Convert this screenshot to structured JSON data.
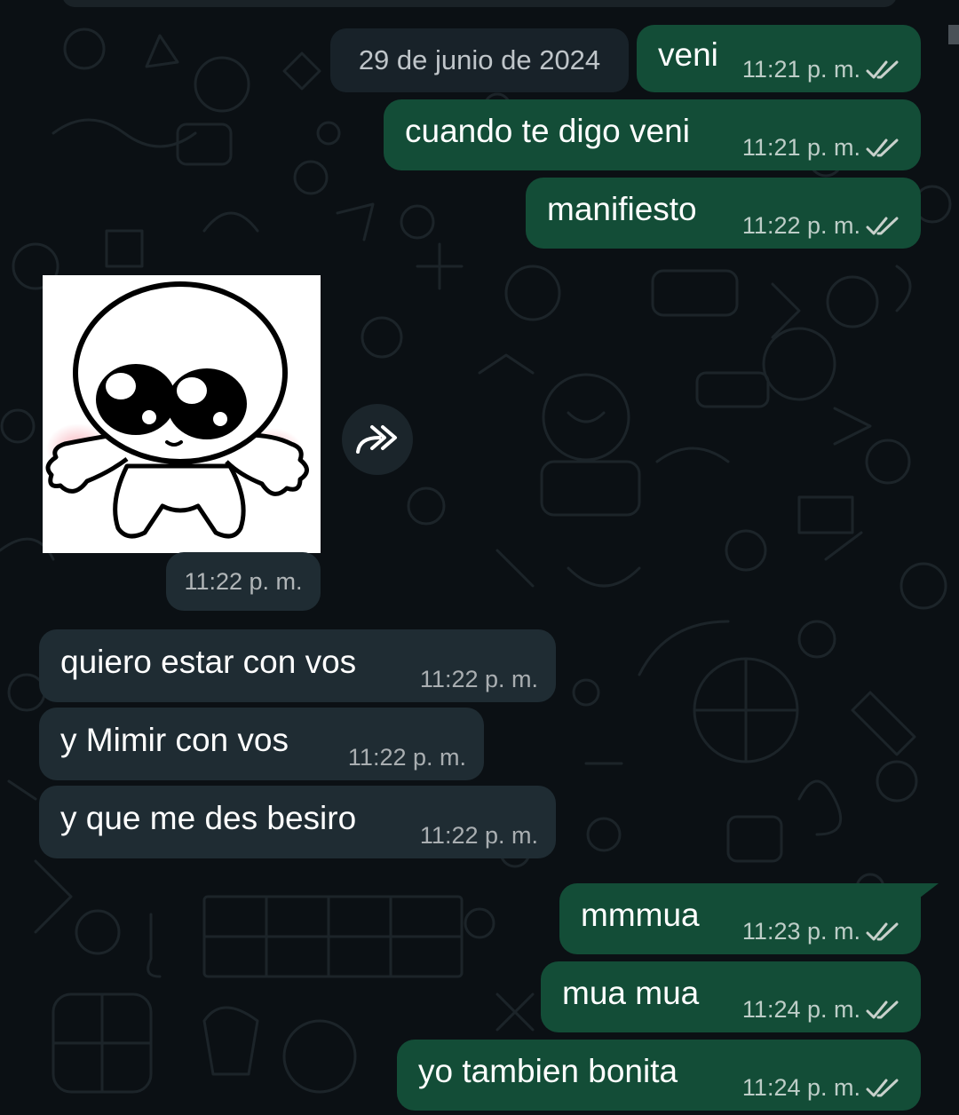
{
  "chat": {
    "date_divider": "29 de junio de 2024",
    "messages": [
      {
        "direction": "out",
        "text": "veni",
        "time": "11:21 p. m.",
        "status": "read"
      },
      {
        "direction": "out",
        "text": "cuando te digo veni",
        "time": "11:21 p. m.",
        "status": "read"
      },
      {
        "direction": "out",
        "text": "manifiesto",
        "time": "11:22 p. m.",
        "status": "read"
      },
      {
        "direction": "in",
        "type": "sticker",
        "time": "11:22 p. m."
      },
      {
        "direction": "in",
        "text": "quiero estar con vos",
        "time": "11:22 p. m."
      },
      {
        "direction": "in",
        "text": "y Mimir con vos",
        "time": "11:22 p. m."
      },
      {
        "direction": "in",
        "text": "y que me des besiro",
        "time": "11:22 p. m."
      },
      {
        "direction": "out",
        "text": "mmmua",
        "time": "11:23 p. m.",
        "status": "read"
      },
      {
        "direction": "out",
        "text": "mua mua",
        "time": "11:24 p. m.",
        "status": "read"
      },
      {
        "direction": "out",
        "text": "yo tambien bonita",
        "time": "11:24 p. m.",
        "status": "read"
      }
    ]
  },
  "icons": {
    "read_receipt": "double-check-icon",
    "forward": "forward-icon"
  },
  "colors": {
    "background": "#0b1014",
    "outgoing_bubble": "#134d37",
    "incoming_bubble": "#1f2c33",
    "read_ticks": "#c9d1cc"
  }
}
